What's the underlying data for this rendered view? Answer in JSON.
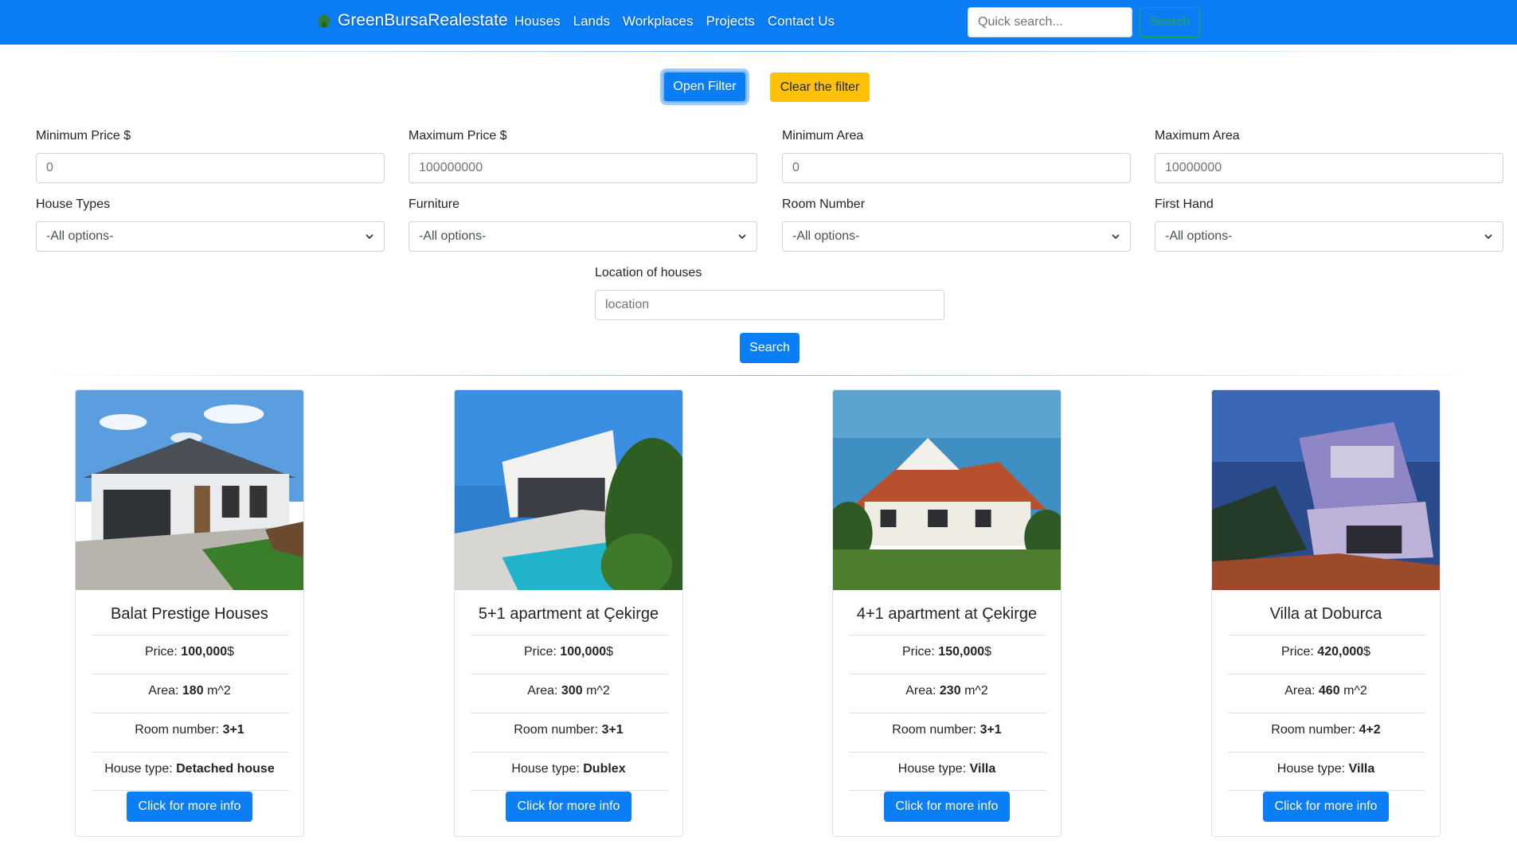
{
  "navbar": {
    "brand": "GreenBursaRealestate",
    "links": [
      "Houses",
      "Lands",
      "Workplaces",
      "Projects",
      "Contact Us"
    ],
    "search_placeholder": "Quick search...",
    "search_button": "Search",
    "color": "#0b7ef5"
  },
  "filter": {
    "open_button": "Open Filter",
    "clear_button": "Clear the filter",
    "min_price": {
      "label": "Minimum Price $",
      "value": "0"
    },
    "max_price": {
      "label": "Maximum Price $",
      "value": "100000000"
    },
    "min_area": {
      "label": "Minimum Area",
      "value": "0"
    },
    "max_area": {
      "label": "Maximum Area",
      "value": "10000000"
    },
    "house_types": {
      "label": "House Types",
      "selected": "-All options-"
    },
    "furniture": {
      "label": "Furniture",
      "selected": "-All options-"
    },
    "room_number": {
      "label": "Room Number",
      "selected": "-All options-"
    },
    "first_hand": {
      "label": "First Hand",
      "selected": "-All options-"
    },
    "location": {
      "label": "Location of houses",
      "placeholder": "location"
    },
    "search_button": "Search"
  },
  "card_labels": {
    "price": "Price:",
    "area": "Area:",
    "area_unit": "m^2",
    "rooms": "Room number:",
    "type": "House type:",
    "button": "Click for more info"
  },
  "listings": [
    {
      "title": "Balat Prestige Houses",
      "price": "100,000",
      "currency": "$",
      "area": "180",
      "rooms": "3+1",
      "type": "Detached house"
    },
    {
      "title": "5+1 apartment at Çekirge",
      "price": "100,000",
      "currency": "$",
      "area": "300",
      "rooms": "3+1",
      "type": "Dublex"
    },
    {
      "title": "4+1 apartment at Çekirge",
      "price": "150,000",
      "currency": "$",
      "area": "230",
      "rooms": "3+1",
      "type": "Villa"
    },
    {
      "title": "Villa at Doburca",
      "price": "420,000",
      "currency": "$",
      "area": "460",
      "rooms": "4+2",
      "type": "Villa"
    }
  ]
}
